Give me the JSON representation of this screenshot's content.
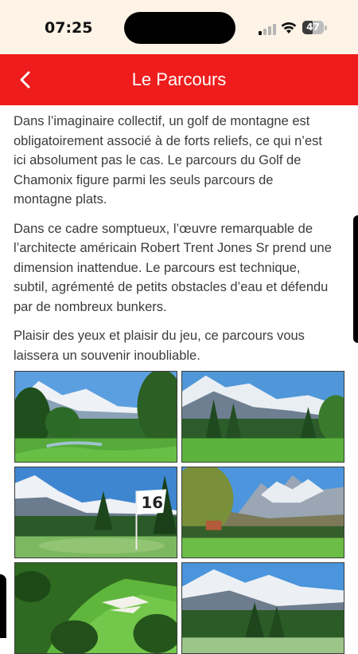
{
  "status_bar": {
    "time": "07:25",
    "battery_level": "47",
    "battery_fraction": 0.47,
    "signal_bars_active": 1,
    "icons": [
      "signal-icon",
      "wifi-icon",
      "battery-icon"
    ]
  },
  "header": {
    "title": "Le Parcours",
    "background_color": "#ee1c1c",
    "back_icon": "chevron-left-icon"
  },
  "content": {
    "paragraphs": [
      "Dans l’imaginaire collectif, un golf de montagne est obligatoirement associé à de forts reliefs, ce qui n’est ici absolument pas le cas. Le parcours du Golf de Chamonix figure parmi les seuls parcours de montagne plats.",
      "Dans ce cadre somptueux, l’œuvre remarquable de l’architecte américain Robert Trent Jones Sr prend une dimension inattendue. Le parcours est technique, subtil, agrémenté de petits obstacles d’eau et défendu par de nombreux bunkers.",
      "Plaisir des yeux et plaisir du jeu, ce parcours vous laissera un souvenir inoubliable."
    ]
  },
  "gallery": {
    "flag_number": "16",
    "photos": [
      "photo-1",
      "photo-2",
      "photo-3",
      "photo-4",
      "photo-5",
      "photo-6"
    ]
  }
}
